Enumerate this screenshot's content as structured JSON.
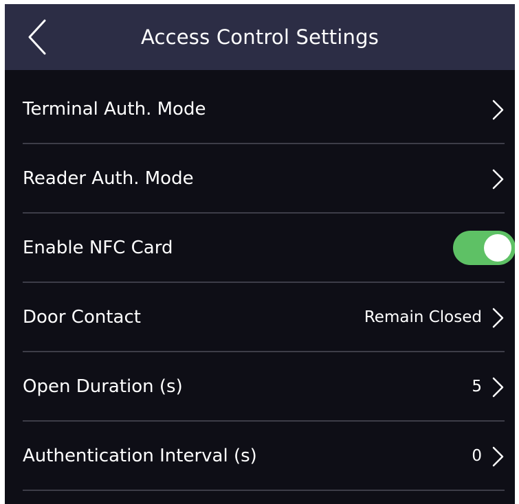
{
  "header": {
    "title": "Access Control Settings",
    "back_icon": "chevron-left-icon"
  },
  "colors": {
    "header_bg": "#2c2d45",
    "body_bg": "#0e0e16",
    "toggle_on": "#5ec165",
    "divider": "#3d3d48",
    "text": "#ffffff"
  },
  "settings": {
    "terminal_auth_mode": {
      "label": "Terminal Auth. Mode",
      "icon": "chevron-right-icon"
    },
    "reader_auth_mode": {
      "label": "Reader Auth. Mode",
      "icon": "chevron-right-icon"
    },
    "enable_nfc_card": {
      "label": "Enable NFC Card",
      "enabled": true
    },
    "door_contact": {
      "label": "Door Contact",
      "value": "Remain Closed",
      "icon": "chevron-right-icon"
    },
    "open_duration": {
      "label": "Open Duration (s)",
      "value": "5",
      "icon": "chevron-right-icon"
    },
    "authentication_interval": {
      "label": "Authentication Interval (s)",
      "value": "0",
      "icon": "chevron-right-icon"
    }
  }
}
